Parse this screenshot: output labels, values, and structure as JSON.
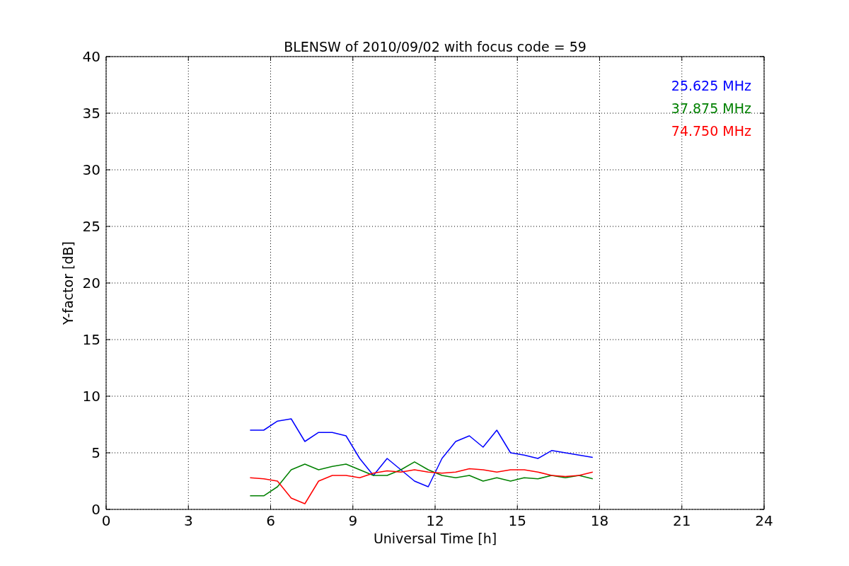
{
  "chart": {
    "chart_data": {
      "type": "line",
      "title": "BLENSW of 2010/09/02 with focus code = 59",
      "xlabel": "Universal Time [h]",
      "ylabel": "Y-factor [dB]",
      "x": [
        5.25,
        5.75,
        6.25,
        6.75,
        7.25,
        7.75,
        8.25,
        8.75,
        9.25,
        9.75,
        10.25,
        10.75,
        11.25,
        11.75,
        12.25,
        12.75,
        13.25,
        13.75,
        14.25,
        14.75,
        15.25,
        15.75,
        16.25,
        16.75,
        17.25,
        17.75
      ],
      "series": [
        {
          "name": "25.625 MHz",
          "color": "#0000ff",
          "values": [
            7.0,
            7.0,
            7.8,
            8.0,
            6.0,
            6.8,
            6.8,
            6.5,
            4.5,
            3.0,
            4.5,
            3.5,
            2.5,
            2.0,
            4.5,
            6.0,
            6.5,
            5.5,
            7.0,
            5.0,
            4.8,
            4.5,
            5.2,
            5.0,
            4.8,
            4.6
          ]
        },
        {
          "name": "37.875 MHz",
          "color": "#008000",
          "values": [
            1.2,
            1.2,
            2.0,
            3.5,
            4.0,
            3.5,
            3.8,
            4.0,
            3.5,
            3.0,
            3.0,
            3.5,
            4.2,
            3.5,
            3.0,
            2.8,
            3.0,
            2.5,
            2.8,
            2.5,
            2.8,
            2.7,
            3.0,
            2.8,
            3.0,
            2.7
          ]
        },
        {
          "name": "74.750 MHz",
          "color": "#ff0000",
          "values": [
            2.8,
            2.7,
            2.5,
            1.0,
            0.5,
            2.5,
            3.0,
            3.0,
            2.8,
            3.2,
            3.4,
            3.3,
            3.5,
            3.3,
            3.2,
            3.3,
            3.6,
            3.5,
            3.3,
            3.5,
            3.5,
            3.3,
            3.0,
            2.9,
            3.0,
            3.3
          ]
        }
      ],
      "grid": true,
      "xlim": [
        0,
        24
      ],
      "ylim": [
        0,
        40
      ],
      "xticks": [
        0,
        3,
        6,
        9,
        12,
        15,
        18,
        21,
        24
      ],
      "yticks": [
        0,
        5,
        10,
        15,
        20,
        25,
        30,
        35,
        40
      ]
    }
  }
}
